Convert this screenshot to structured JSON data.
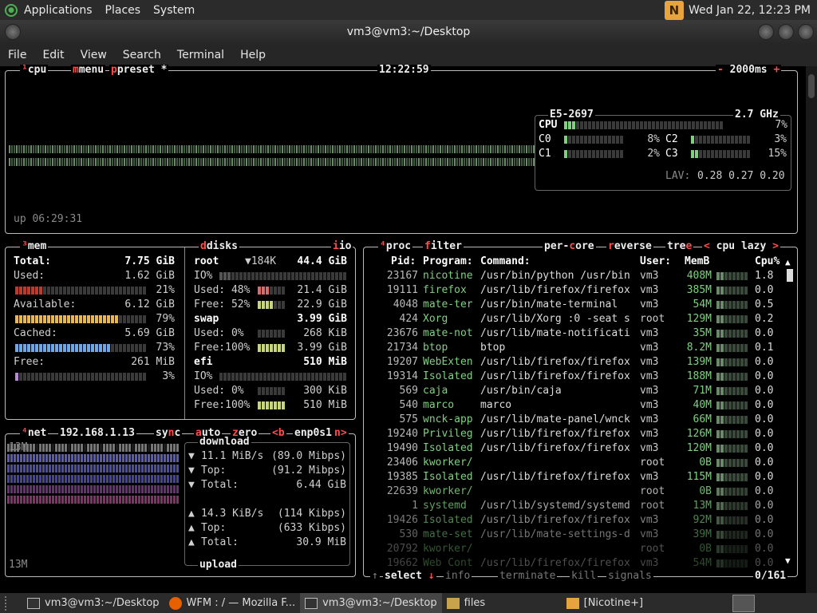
{
  "top_panel": {
    "menus": [
      "Applications",
      "Places",
      "System"
    ],
    "clock": "Wed Jan 22, 12:23 PM",
    "nicotine_icon_text": "N"
  },
  "window": {
    "title": "vm3@vm3:~/Desktop"
  },
  "menubar": [
    "File",
    "Edit",
    "View",
    "Search",
    "Terminal",
    "Help"
  ],
  "btop": {
    "cpu_box": {
      "tabs": {
        "cpu": "cpu",
        "menu": "menu",
        "preset": "preset",
        "star": "*"
      },
      "clock": "12:22:59",
      "interval": "2000ms",
      "minus": "-",
      "plus": "+",
      "uptime": "up 06:29:31",
      "model": "E5-2697",
      "freq": "2.7 GHz",
      "cores": [
        {
          "name": "CPU",
          "pct": "7%",
          "level": 0.07
        },
        {
          "name": "C0",
          "pct": "8%",
          "level": 0.08
        },
        {
          "name": "C1",
          "pct": "2%",
          "level": 0.02
        },
        {
          "name": "C2",
          "pct": "3%",
          "level": 0.03
        },
        {
          "name": "C3",
          "pct": "15%",
          "level": 0.15
        }
      ],
      "lav_label": "LAV:",
      "lav": "0.28 0.27 0.20"
    },
    "mem_box": {
      "title": "mem",
      "total_label": "Total:",
      "total": "7.75 GiB",
      "used_label": "Used:",
      "used": "1.62 GiB",
      "used_pct": "21%",
      "used_level": 0.21,
      "available_label": "Available:",
      "available": "6.12 GiB",
      "available_pct": "79%",
      "available_level": 0.79,
      "cached_label": "Cached:",
      "cached": "5.69 GiB",
      "cached_pct": "73%",
      "cached_level": 0.73,
      "free_label": "Free:",
      "free": "261 MiB",
      "free_pct": "3%",
      "free_level": 0.03
    },
    "disks_box": {
      "title": "disks",
      "io_tab": "io",
      "root": {
        "name": "root",
        "io_rate": "▼184K",
        "size": "44.4 GiB",
        "io_label": "IO%",
        "used_label": "Used: 48%",
        "used": "21.4 GiB",
        "used_level": 0.48,
        "free_label": "Free: 52%",
        "free": "22.9 GiB",
        "free_level": 0.52
      },
      "swap": {
        "name": "swap",
        "size": "3.99 GiB",
        "used_label": "Used:  0%",
        "used": "268 KiB",
        "used_level": 0.0,
        "free_label": "Free:100%",
        "free": "3.99 GiB",
        "free_level": 1.0
      },
      "efi": {
        "name": "efi",
        "size": "510 MiB",
        "io_label": "IO%",
        "used_label": "Used:  0%",
        "used": "300 KiB",
        "used_level": 0.0,
        "free_label": "Free:100%",
        "free": "510 MiB",
        "free_level": 1.0
      }
    },
    "net_box": {
      "title": "net",
      "ip": "192.168.1.13",
      "sync": "sync",
      "auto": "auto",
      "zero": "zero",
      "prev": "<b",
      "iface": "enp0s1",
      "next": "n>",
      "scale_top": "13M",
      "scale_bottom": "13M",
      "download_label": "download",
      "dl_rate": "11.1 MiB/s",
      "dl_rate_bits": "(89.0 Mibps)",
      "dl_top_label": "Top:",
      "dl_top": "(91.2 Mibps)",
      "dl_total_label": "Total:",
      "dl_total": "6.44 GiB",
      "ul_rate": "14.3 KiB/s",
      "ul_rate_bits": "(114 Kibps)",
      "ul_top_label": "Top:",
      "ul_top": "(633 Kibps)",
      "ul_total_label": "Total:",
      "ul_total": "30.9 MiB",
      "upload_label": "upload"
    },
    "proc_box": {
      "tabs": {
        "proc": "proc",
        "filter": "filter",
        "per_core": "per-core",
        "reverse": "reverse",
        "tree": "tree",
        "sort": "cpu lazy",
        "sort_prev": "<",
        "sort_next": ">"
      },
      "headers": {
        "pid": "Pid:",
        "program": "Program:",
        "command": "Command:",
        "user": "User:",
        "mem": "MemB",
        "cpu": "Cpu%"
      },
      "rows": [
        {
          "pid": "23167",
          "program": "nicotine",
          "command": "/usr/bin/python /usr/bin",
          "user": "vm3",
          "mem": "408M",
          "cpu": "1.8"
        },
        {
          "pid": "19111",
          "program": "firefox",
          "command": "/usr/lib/firefox/firefox",
          "user": "vm3",
          "mem": "385M",
          "cpu": "0.0"
        },
        {
          "pid": "4048",
          "program": "mate-ter",
          "command": "/usr/bin/mate-terminal",
          "user": "vm3",
          "mem": "54M",
          "cpu": "0.5"
        },
        {
          "pid": "424",
          "program": "Xorg",
          "command": "/usr/lib/Xorg :0 -seat s",
          "user": "root",
          "mem": "129M",
          "cpu": "0.2"
        },
        {
          "pid": "23676",
          "program": "mate-not",
          "command": "/usr/lib/mate-notificati",
          "user": "vm3",
          "mem": "35M",
          "cpu": "0.0"
        },
        {
          "pid": "21734",
          "program": "btop",
          "command": "btop",
          "user": "vm3",
          "mem": "8.2M",
          "cpu": "0.1"
        },
        {
          "pid": "19207",
          "program": "WebExten",
          "command": "/usr/lib/firefox/firefox",
          "user": "vm3",
          "mem": "139M",
          "cpu": "0.0"
        },
        {
          "pid": "19314",
          "program": "Isolated",
          "command": "/usr/lib/firefox/firefox",
          "user": "vm3",
          "mem": "188M",
          "cpu": "0.0"
        },
        {
          "pid": "569",
          "program": "caja",
          "command": "/usr/bin/caja",
          "user": "vm3",
          "mem": "71M",
          "cpu": "0.0"
        },
        {
          "pid": "540",
          "program": "marco",
          "command": "marco",
          "user": "vm3",
          "mem": "40M",
          "cpu": "0.0"
        },
        {
          "pid": "575",
          "program": "wnck-app",
          "command": "/usr/lib/mate-panel/wnck",
          "user": "vm3",
          "mem": "66M",
          "cpu": "0.0"
        },
        {
          "pid": "19240",
          "program": "Privileg",
          "command": "/usr/lib/firefox/firefox",
          "user": "vm3",
          "mem": "126M",
          "cpu": "0.0"
        },
        {
          "pid": "19490",
          "program": "Isolated",
          "command": "/usr/lib/firefox/firefox",
          "user": "vm3",
          "mem": "120M",
          "cpu": "0.0"
        },
        {
          "pid": "23406",
          "program": "kworker/",
          "command": "",
          "user": "root",
          "mem": "0B",
          "cpu": "0.0"
        },
        {
          "pid": "19385",
          "program": "Isolated",
          "command": "/usr/lib/firefox/firefox",
          "user": "vm3",
          "mem": "115M",
          "cpu": "0.0"
        },
        {
          "pid": "22639",
          "program": "kworker/",
          "command": "",
          "user": "root",
          "mem": "0B",
          "cpu": "0.0"
        },
        {
          "pid": "1",
          "program": "systemd",
          "command": "/usr/lib/systemd/systemd",
          "user": "root",
          "mem": "13M",
          "cpu": "0.0"
        },
        {
          "pid": "19426",
          "program": "Isolated",
          "command": "/usr/lib/firefox/firefox",
          "user": "vm3",
          "mem": "92M",
          "cpu": "0.0"
        },
        {
          "pid": "530",
          "program": "mate-set",
          "command": "/usr/lib/mate-settings-d",
          "user": "vm3",
          "mem": "39M",
          "cpu": "0.0"
        },
        {
          "pid": "20792",
          "program": "kworker/",
          "command": "",
          "user": "root",
          "mem": "0B",
          "cpu": "0.0"
        },
        {
          "pid": "19662",
          "program": "Web Cont",
          "command": "/usr/lib/firefox/firefox",
          "user": "vm3",
          "mem": "54M",
          "cpu": "0.0"
        }
      ],
      "footer": {
        "select": "select",
        "info": "info",
        "terminate": "terminate",
        "kill": "kill",
        "signals": "signals",
        "count": "0/161"
      }
    }
  },
  "taskbar": [
    {
      "label": "vm3@vm3:~/Desktop",
      "icon": "terminal-icon",
      "active": false
    },
    {
      "label": "WFM : / — Mozilla F...",
      "icon": "firefox-icon",
      "active": false
    },
    {
      "label": "vm3@vm3:~/Desktop",
      "icon": "terminal-icon",
      "active": true
    },
    {
      "label": "files",
      "icon": "folder-icon",
      "active": false
    },
    {
      "label": "[Nicotine+]",
      "icon": "nicotine-icon",
      "active": false
    }
  ],
  "colors": {
    "accent_red": "#ff4d4d",
    "proc_green": "#7fd17f",
    "mem_blue": "#6aa9e6",
    "bar_dark": "#3a3a3a"
  }
}
